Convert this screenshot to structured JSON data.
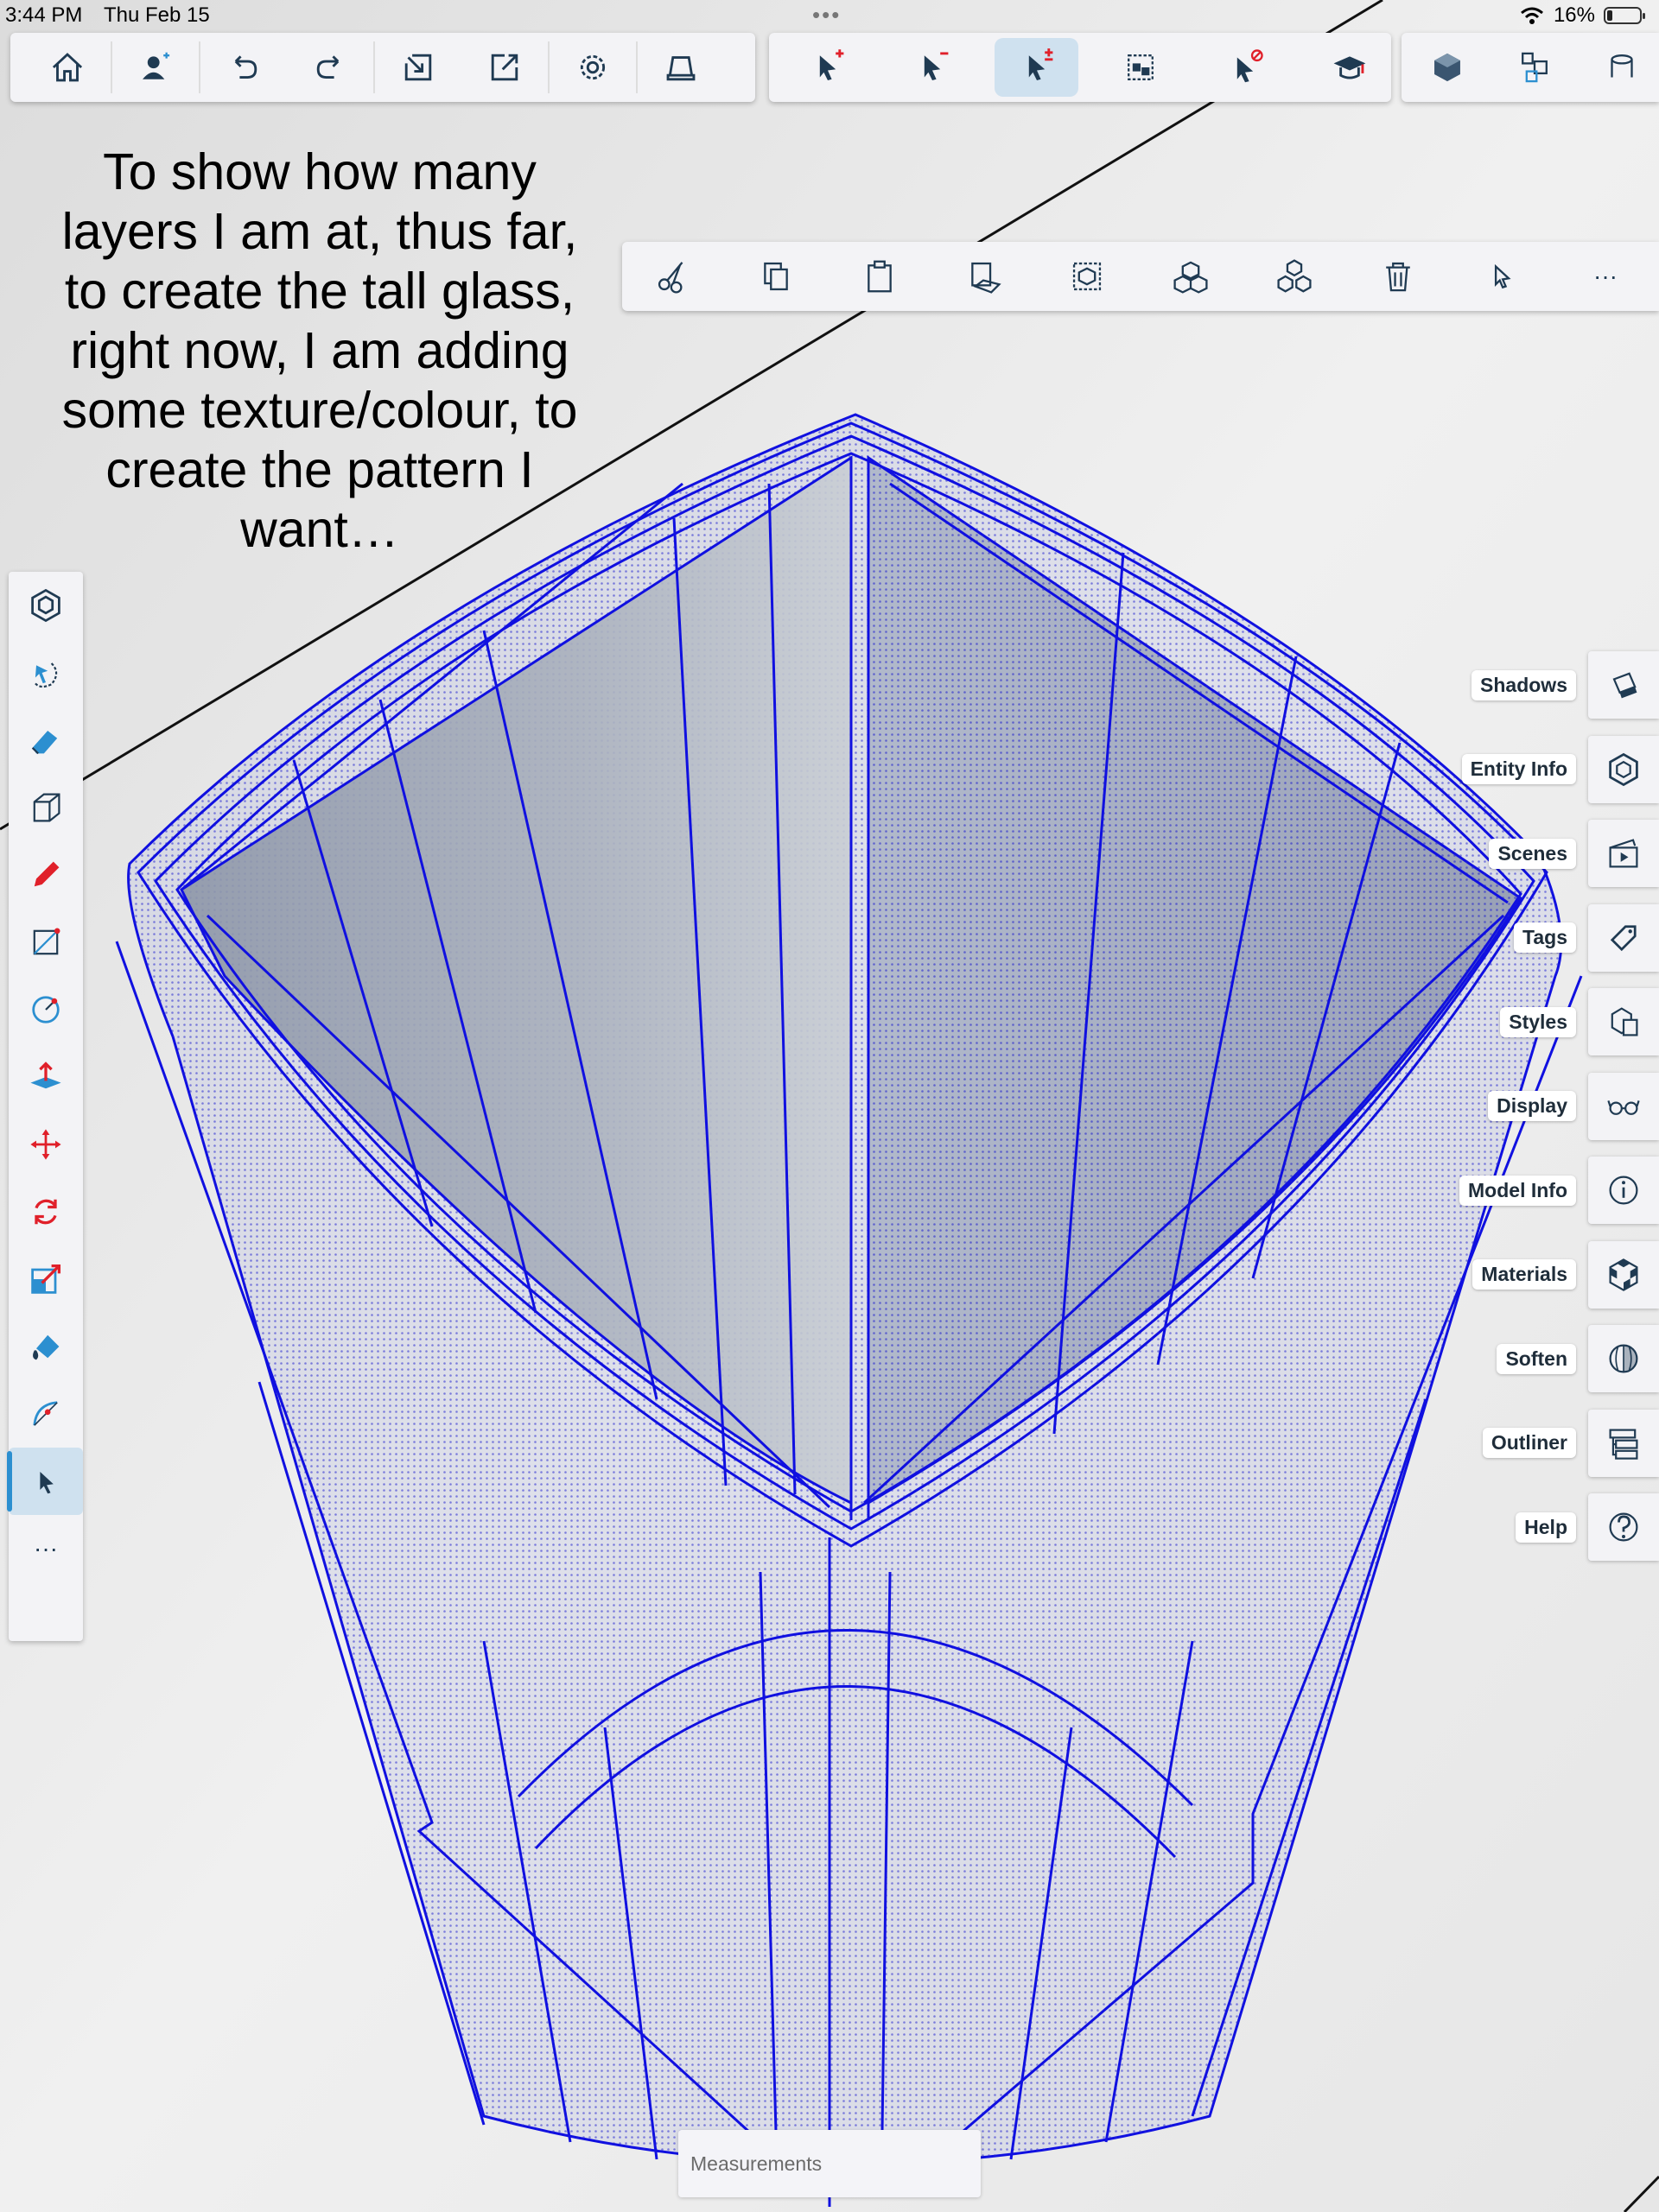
{
  "status_bar": {
    "time": "3:44 PM",
    "date": "Thu Feb 15",
    "battery_percent": "16%",
    "battery_level": 0.16,
    "icons": [
      "wifi-icon",
      "battery-icon"
    ]
  },
  "overlay_caption": "To show how many layers I am at, thus far, to create the tall glass, right now, I am adding some texture/colour, to create the pattern I want…",
  "top_toolbar": {
    "main_icons": [
      "home-icon",
      "account-icon",
      "undo-icon",
      "redo-icon",
      "import-icon",
      "export-icon",
      "settings-icon",
      "print-icon"
    ],
    "selection_icons": [
      "select-add-icon",
      "select-subtract-icon",
      "select-toggle-icon",
      "select-group-icon",
      "select-none-icon",
      "learn-icon"
    ],
    "selection_active": "select-toggle-icon",
    "view_icons": [
      "iso-view-icon",
      "components-icon",
      "more-view-icon"
    ]
  },
  "context_toolbar": {
    "icons": [
      "cut-icon",
      "copy-icon",
      "paste-icon",
      "paste-in-place-icon",
      "make-group-icon",
      "make-component-icon",
      "explode-icon",
      "delete-icon",
      "select-icon",
      "more-icon"
    ],
    "more_label": "···"
  },
  "left_toolbar": {
    "icons": [
      "model-icon",
      "orbit-icon",
      "eraser-icon",
      "box-icon",
      "pencil-icon",
      "rectangle-icon",
      "circle-icon",
      "push-pull-icon",
      "move-icon",
      "rotate-icon",
      "scale-icon",
      "paint-bucket-icon",
      "arc-icon",
      "select-arrow-icon"
    ],
    "active": "select-arrow-icon",
    "more_label": "···"
  },
  "right_tray": {
    "items": [
      {
        "label": "Shadows",
        "icon": "shadows-icon"
      },
      {
        "label": "Entity Info",
        "icon": "entity-info-icon"
      },
      {
        "label": "Scenes",
        "icon": "scenes-icon"
      },
      {
        "label": "Tags",
        "icon": "tags-icon"
      },
      {
        "label": "Styles",
        "icon": "styles-icon"
      },
      {
        "label": "Display",
        "icon": "display-icon"
      },
      {
        "label": "Model Info",
        "icon": "model-info-icon"
      },
      {
        "label": "Materials",
        "icon": "materials-icon"
      },
      {
        "label": "Soften",
        "icon": "soften-icon"
      },
      {
        "label": "Outliner",
        "icon": "outliner-icon"
      },
      {
        "label": "Help",
        "icon": "help-icon"
      }
    ]
  },
  "measurements": {
    "placeholder": "Measurements"
  },
  "colors": {
    "selection_blue": "#1010e0",
    "accent": "#2c8fd0",
    "red": "#e0202a",
    "icon_dark": "#1f3a52"
  }
}
